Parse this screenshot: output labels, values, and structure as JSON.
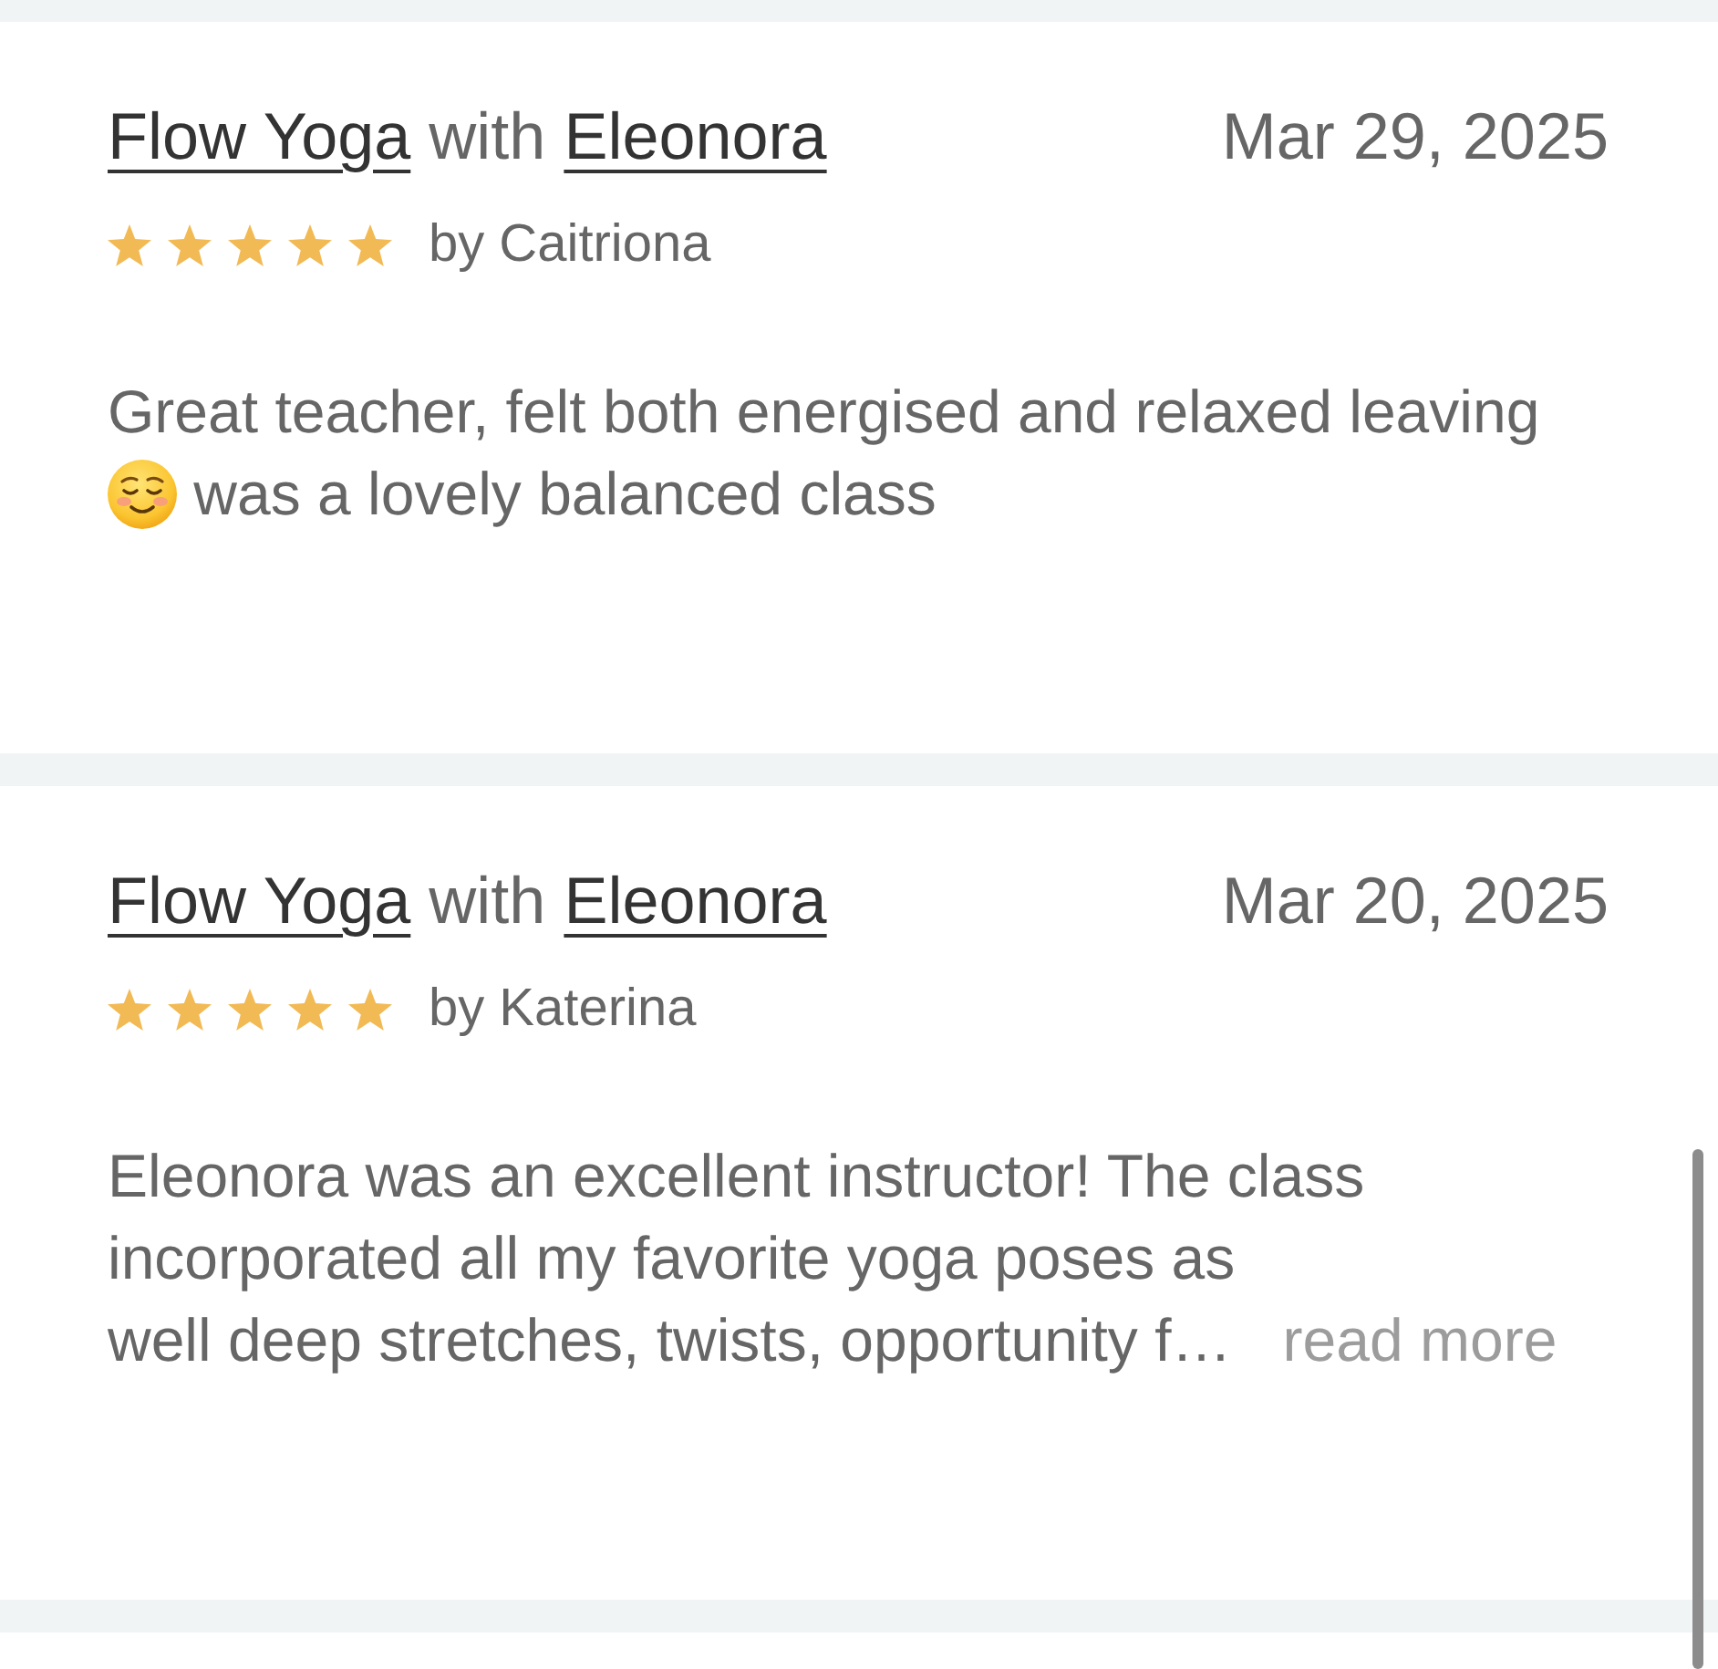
{
  "reviews": [
    {
      "class_name": "Flow Yoga",
      "connector": "with",
      "instructor": "Eleonora",
      "date": "Mar 29, 2025",
      "stars": 5,
      "byline": "by Caitriona",
      "body": [
        {
          "kind": "text",
          "text": "Great teacher, felt both energised and relaxed leaving"
        },
        {
          "kind": "emoji"
        },
        {
          "kind": "text",
          "text": "was a lovely balanced class"
        }
      ]
    },
    {
      "class_name": "Flow Yoga",
      "connector": "with",
      "instructor": "Eleonora",
      "date": "Mar 20, 2025",
      "stars": 5,
      "byline": "by Katerina",
      "body": [
        {
          "kind": "text",
          "text": "Eleonora was an excellent instructor! The class incorporated all my favorite yoga poses as\nwell deep stretches, twists, opportunity f…"
        }
      ],
      "read_more": "read more"
    }
  ]
}
